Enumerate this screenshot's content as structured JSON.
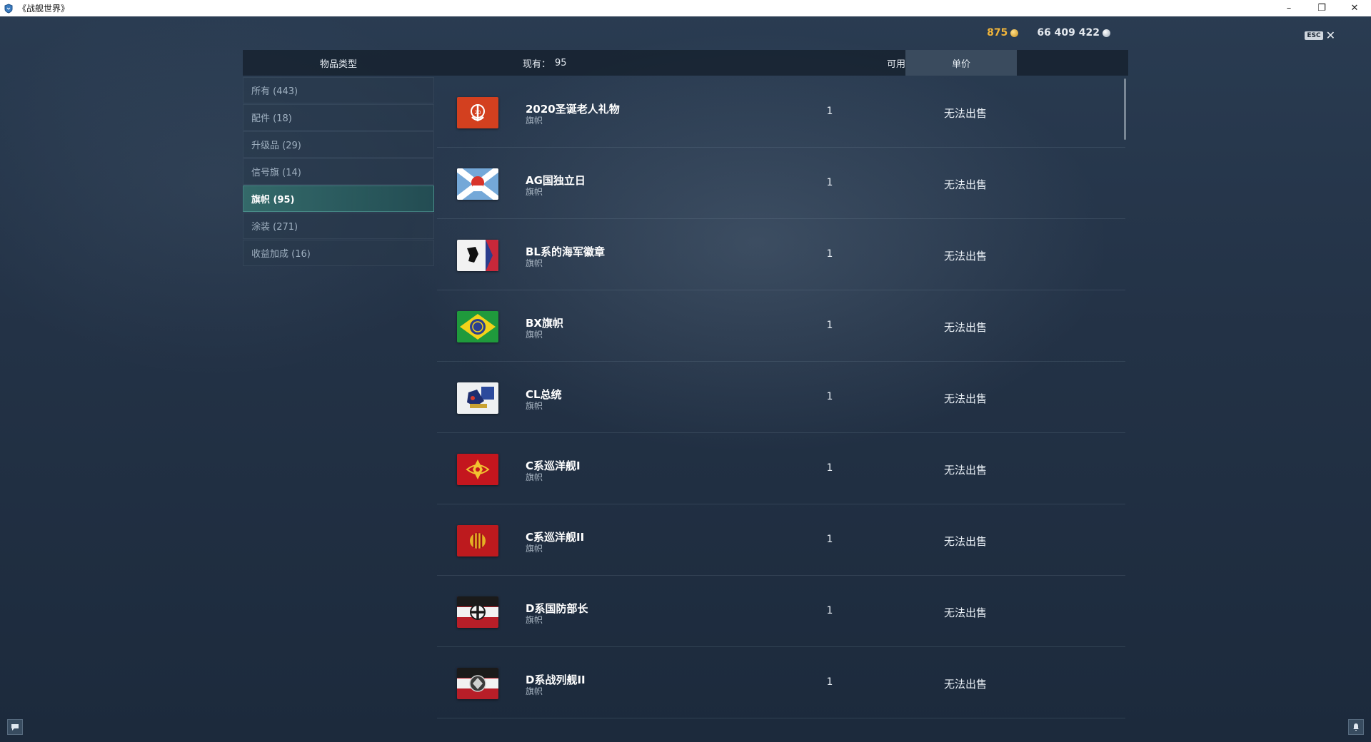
{
  "window": {
    "title": "《战舰世界》"
  },
  "currencies": {
    "gold": "875",
    "silver": "66 409 422"
  },
  "esc_label": "ESC",
  "header": {
    "type_label": "物品类型",
    "owned_label": "现有：",
    "owned_count": "95",
    "available_label": "可用",
    "price_label": "单价"
  },
  "sidebar": {
    "items": [
      {
        "label": "所有 (443)"
      },
      {
        "label": "配件 (18)"
      },
      {
        "label": "升级品 (29)"
      },
      {
        "label": "信号旗 (14)"
      },
      {
        "label": "旗帜 (95)"
      },
      {
        "label": "涂装 (271)"
      },
      {
        "label": "收益加成 (16)"
      }
    ],
    "active_index": 4
  },
  "items": [
    {
      "name": "2020圣诞老人礼物",
      "type": "旗帜",
      "available": "1",
      "price": "无法出售",
      "icon": "flag-2020-santa-icon"
    },
    {
      "name": "AG国独立日",
      "type": "旗帜",
      "available": "1",
      "price": "无法出售",
      "icon": "flag-ag-independence-icon"
    },
    {
      "name": "BL系的海军徽章",
      "type": "旗帜",
      "available": "1",
      "price": "无法出售",
      "icon": "flag-bl-naval-insignia-icon"
    },
    {
      "name": "BX旗帜",
      "type": "旗帜",
      "available": "1",
      "price": "无法出售",
      "icon": "flag-bx-icon"
    },
    {
      "name": "CL总统",
      "type": "旗帜",
      "available": "1",
      "price": "无法出售",
      "icon": "flag-cl-president-icon"
    },
    {
      "name": "C系巡洋舰I",
      "type": "旗帜",
      "available": "1",
      "price": "无法出售",
      "icon": "flag-c-cruiser-1-icon"
    },
    {
      "name": "C系巡洋舰II",
      "type": "旗帜",
      "available": "1",
      "price": "无法出售",
      "icon": "flag-c-cruiser-2-icon"
    },
    {
      "name": "D系国防部长",
      "type": "旗帜",
      "available": "1",
      "price": "无法出售",
      "icon": "flag-d-defense-minister-icon"
    },
    {
      "name": "D系战列舰II",
      "type": "旗帜",
      "available": "1",
      "price": "无法出售",
      "icon": "flag-d-battleship-2-icon"
    }
  ],
  "colors": {
    "accent_active": "#2f6f70",
    "gold": "#f0b43a",
    "background": "#233246"
  }
}
